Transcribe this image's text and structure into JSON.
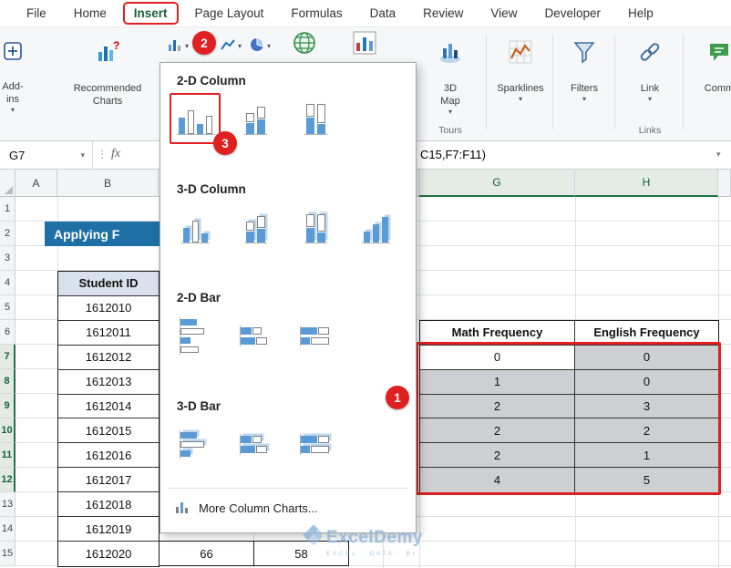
{
  "colors": {
    "annotation_red": "#e02020",
    "banner_blue": "#1d6fa5",
    "excel_green": "#217346",
    "selection_gray": "#cdcfd2",
    "chart_blue": "#5b9bd5"
  },
  "icons": {
    "chevron_down": "▾",
    "dots_handle": "⋮"
  },
  "tabs": [
    "File",
    "Home",
    "Insert",
    "Page Layout",
    "Formulas",
    "Data",
    "Review",
    "View",
    "Developer",
    "Help"
  ],
  "ribbon": {
    "add_ins": {
      "line1": "Add-",
      "line2": "ins"
    },
    "recommended_charts": {
      "line1": "Recommended",
      "line2": "Charts"
    },
    "map_3d": {
      "line1": "3D",
      "line2": "Map"
    },
    "sparklines": "Sparklines",
    "filters": "Filters",
    "link": "Link",
    "comments": "Comm",
    "groups": {
      "tours": "Tours",
      "links": "Links"
    }
  },
  "formula_bar": {
    "name_box": "G7",
    "fx": "fx",
    "formula_visible": "C15,F7:F11)"
  },
  "chart_menu": {
    "sections": [
      {
        "title": "2-D Column"
      },
      {
        "title": "3-D Column"
      },
      {
        "title": "2-D Bar"
      },
      {
        "title": "3-D Bar"
      }
    ],
    "more_item": "More Column Charts..."
  },
  "annotations": {
    "step1": "1",
    "step2": "2",
    "step3": "3"
  },
  "watermark": {
    "brand": "ExcelDemy",
    "tagline": "EXCEL · DATA · BI"
  },
  "sheet": {
    "visible_col_headers": {
      "a": "A",
      "b": "B",
      "g": "G",
      "h": "H"
    },
    "row_headers": [
      "1",
      "2",
      "3",
      "4",
      "5",
      "6",
      "7",
      "8",
      "9",
      "10",
      "11",
      "12",
      "13",
      "14",
      "15"
    ],
    "title_partial": "Applying F",
    "student_table": {
      "header": "Student ID",
      "ids": [
        "1612010",
        "1612011",
        "1612012",
        "1612013",
        "1612014",
        "1612015",
        "1612016",
        "1612017",
        "1612018",
        "1612019",
        "1612020"
      ]
    },
    "row15_extra": {
      "c": "66",
      "d": "58"
    },
    "freq_table": {
      "math_header": "Math Frequency",
      "english_header": "English Frequency",
      "rows": [
        [
          "0",
          "0"
        ],
        [
          "1",
          "0"
        ],
        [
          "2",
          "3"
        ],
        [
          "2",
          "2"
        ],
        [
          "2",
          "1"
        ],
        [
          "4",
          "5"
        ]
      ]
    }
  }
}
